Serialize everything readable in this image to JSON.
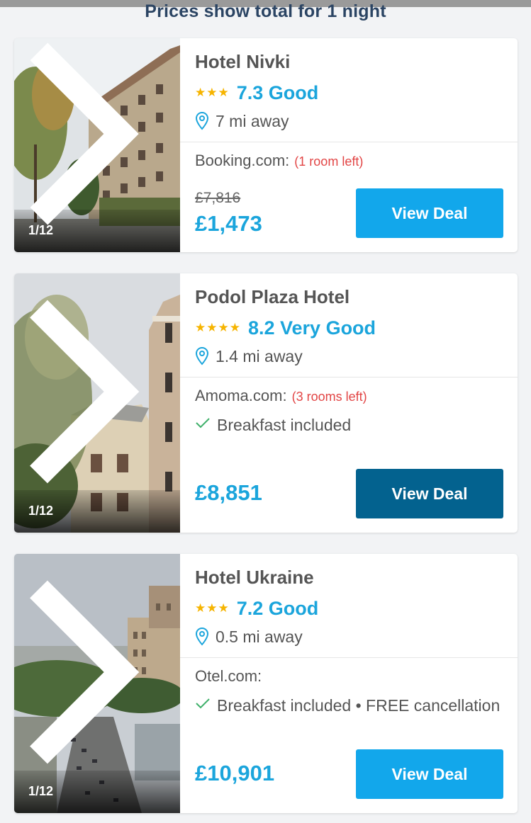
{
  "header": {
    "notice": "Prices show total for 1 night"
  },
  "colors": {
    "accent": "#1ba5dc",
    "button": "#12a7eb",
    "button_pressed": "#03628f",
    "rooms_left": "#e24545",
    "stars": "#f6b400"
  },
  "hotels": [
    {
      "name": "Hotel Nivki",
      "stars": "★★★",
      "star_count": 3,
      "score": "7.3 Good",
      "distance": "7 mi away",
      "provider": "Booking.com:",
      "rooms_left": "(1 room left)",
      "old_price": "£7,816",
      "price": "£1,473",
      "photo_counter": "1/12",
      "button_label": "View Deal"
    },
    {
      "name": "Podol Plaza Hotel",
      "stars": "★★★★",
      "star_count": 4,
      "score": "8.2 Very Good",
      "distance": "1.4 mi away",
      "provider": "Amoma.com:",
      "rooms_left": "(3 rooms left)",
      "feature": "Breakfast included",
      "price": "£8,851",
      "photo_counter": "1/12",
      "button_label": "View Deal"
    },
    {
      "name": "Hotel Ukraine",
      "stars": "★★★",
      "star_count": 3,
      "score": "7.2 Good",
      "distance": "0.5 mi away",
      "provider": "Otel.com:",
      "feature": "Breakfast included • FREE cancellation",
      "price": "£10,901",
      "photo_counter": "1/12",
      "button_label": "View Deal"
    }
  ],
  "icons": {
    "location": "map-pin-icon",
    "check": "check-icon",
    "next": "chevron-right-icon"
  }
}
